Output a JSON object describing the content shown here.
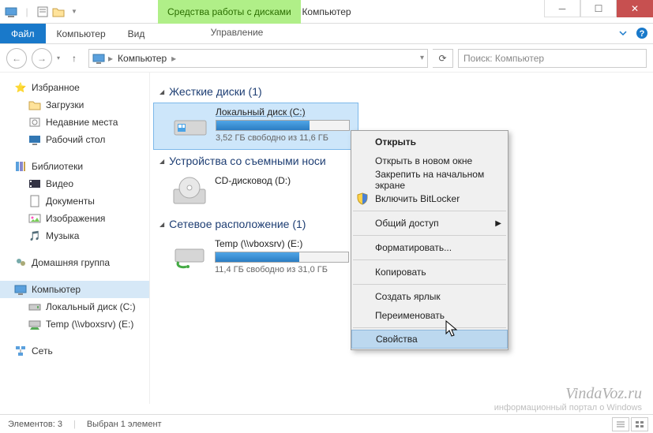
{
  "window": {
    "contextual_tool_title": "Средства работы с дисками",
    "title": "Компьютер"
  },
  "ribbon": {
    "file": "Файл",
    "computer": "Компьютер",
    "view": "Вид",
    "manage": "Управление"
  },
  "address": {
    "location": "Компьютер"
  },
  "search": {
    "placeholder": "Поиск: Компьютер"
  },
  "sidebar": {
    "favorites": "Избранное",
    "downloads": "Загрузки",
    "recent": "Недавние места",
    "desktop": "Рабочий стол",
    "libraries": "Библиотеки",
    "video": "Видео",
    "documents": "Документы",
    "images": "Изображения",
    "music": "Музыка",
    "homegroup": "Домашняя группа",
    "computer": "Компьютер",
    "local_disk": "Локальный диск (C:)",
    "temp": "Temp (\\\\vboxsrv) (E:)",
    "network": "Сеть"
  },
  "groups": {
    "hdd": "Жесткие диски (1)",
    "removable": "Устройства со съемными носи",
    "network": "Сетевое расположение (1)"
  },
  "drives": {
    "c": {
      "name": "Локальный диск (C:)",
      "free_text": "3,52 ГБ свободно из 11,6 ГБ",
      "fill_pct": 70
    },
    "d": {
      "name": "CD-дисковод (D:)"
    },
    "e": {
      "name": "Temp (\\\\vboxsrv) (E:)",
      "free_text": "11,4 ГБ свободно из 31,0 ГБ",
      "fill_pct": 63
    }
  },
  "context_menu": {
    "open": "Открыть",
    "open_new": "Открыть в новом окне",
    "pin": "Закрепить на начальном экране",
    "bitlocker": "Включить BitLocker",
    "share": "Общий доступ",
    "format": "Форматировать...",
    "copy": "Копировать",
    "shortcut": "Создать ярлык",
    "rename": "Переименовать",
    "properties": "Свойства"
  },
  "statusbar": {
    "elements": "Элементов: 3",
    "selected": "Выбран 1 элемент"
  },
  "watermark": {
    "brand": "VindaVoz.ru",
    "tagline": "информационный портал о Windows"
  }
}
